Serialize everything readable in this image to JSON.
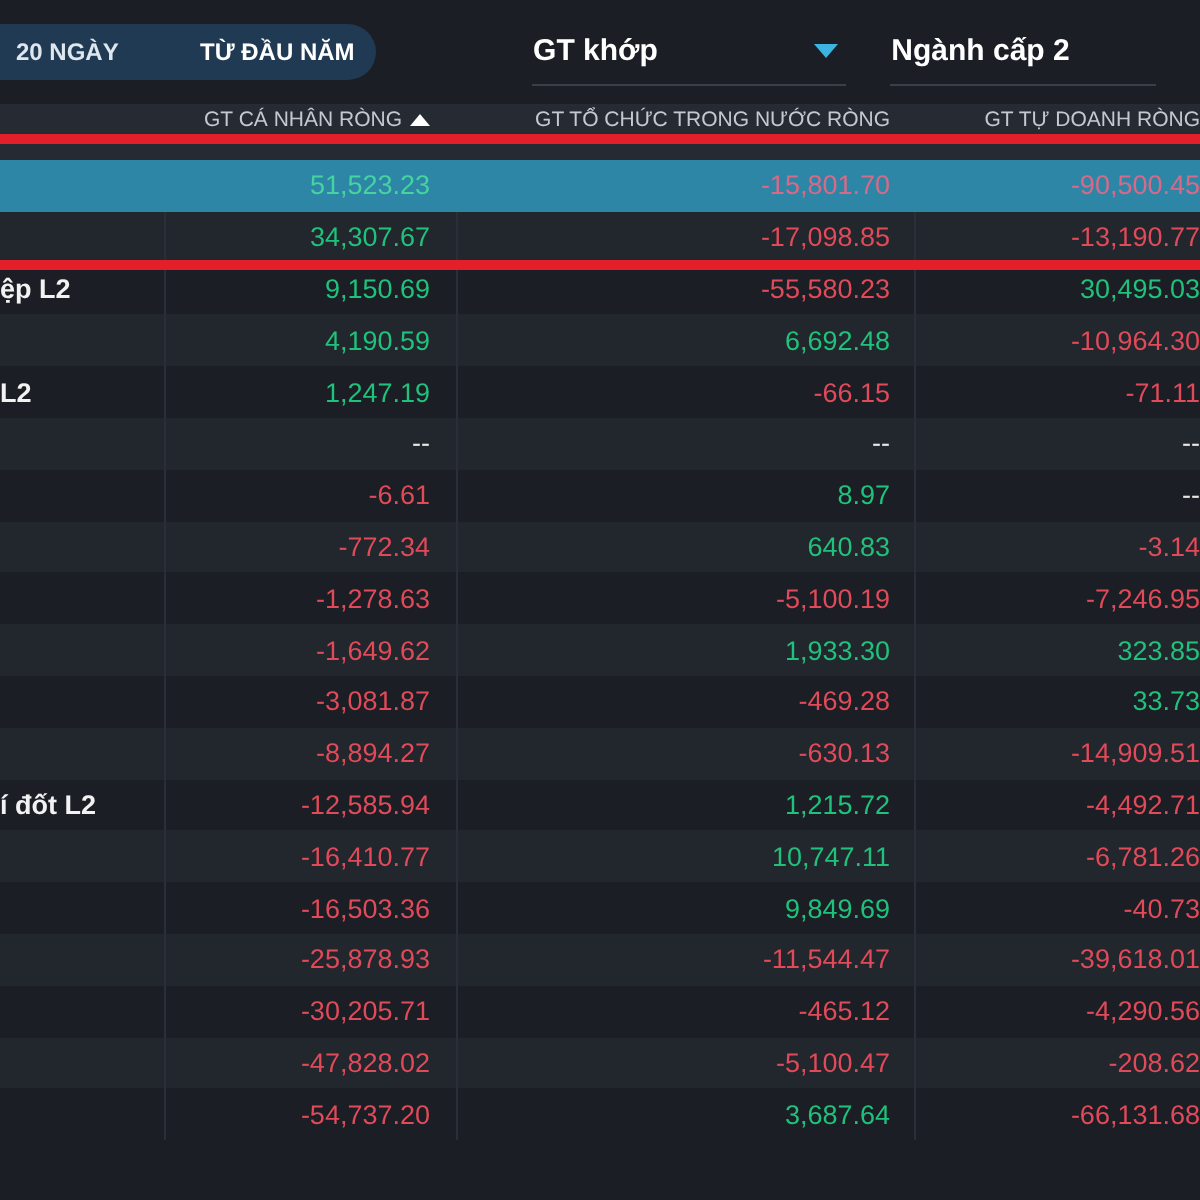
{
  "period_tabs": [
    {
      "label": "20 NGÀY",
      "selected": false
    },
    {
      "label": "TỪ ĐẦU NĂM",
      "selected": true
    }
  ],
  "filters": [
    {
      "value": "GT khớp",
      "caret": true
    },
    {
      "value": "Ngành cấp 2"
    }
  ],
  "table": {
    "columns": [
      {
        "label": "GT CÁ NHÂN RÒNG",
        "sorted": true
      },
      {
        "label": "GT TỔ CHỨC TRONG NƯỚC RÒNG",
        "sorted": false
      },
      {
        "label": "GT TỰ DOANH RÒNG",
        "sorted": false
      }
    ],
    "rows": [
      {
        "selected": true,
        "values": [
          {
            "text": "51,523.23",
            "kind": "up"
          },
          {
            "text": "-15,801.70",
            "kind": "down"
          },
          {
            "text": "-90,500.45",
            "kind": "down"
          }
        ]
      },
      {
        "selected": false,
        "marked": true,
        "values": [
          {
            "text": "34,307.67",
            "kind": "up"
          },
          {
            "text": "-17,098.85",
            "kind": "down"
          },
          {
            "text": "-13,190.77",
            "kind": "down"
          }
        ]
      },
      {
        "selected": false,
        "name": "ệp L2",
        "values": [
          {
            "text": "9,150.69",
            "kind": "up"
          },
          {
            "text": "-55,580.23",
            "kind": "down"
          },
          {
            "text": "30,495.03",
            "kind": "up"
          }
        ]
      },
      {
        "selected": false,
        "values": [
          {
            "text": "4,190.59",
            "kind": "up"
          },
          {
            "text": "6,692.48",
            "kind": "up"
          },
          {
            "text": "-10,964.30",
            "kind": "down"
          }
        ]
      },
      {
        "selected": false,
        "name": "L2",
        "values": [
          {
            "text": "1,247.19",
            "kind": "up"
          },
          {
            "text": "-66.15",
            "kind": "down"
          },
          {
            "text": "-71.11",
            "kind": "down"
          }
        ]
      },
      {
        "selected": false,
        "values": [
          {
            "text": "--",
            "kind": "none"
          },
          {
            "text": "--",
            "kind": "none"
          },
          {
            "text": "--",
            "kind": "none"
          }
        ]
      },
      {
        "selected": false,
        "values": [
          {
            "text": "-6.61",
            "kind": "down"
          },
          {
            "text": "8.97",
            "kind": "up"
          },
          {
            "text": "--",
            "kind": "none"
          }
        ]
      },
      {
        "selected": false,
        "values": [
          {
            "text": "-772.34",
            "kind": "down"
          },
          {
            "text": "640.83",
            "kind": "up"
          },
          {
            "text": "-3.14",
            "kind": "down"
          }
        ]
      },
      {
        "selected": false,
        "values": [
          {
            "text": "-1,278.63",
            "kind": "down"
          },
          {
            "text": "-5,100.19",
            "kind": "down"
          },
          {
            "text": "-7,246.95",
            "kind": "down"
          }
        ]
      },
      {
        "selected": false,
        "values": [
          {
            "text": "-1,649.62",
            "kind": "down"
          },
          {
            "text": "1,933.30",
            "kind": "up"
          },
          {
            "text": "323.85",
            "kind": "up"
          }
        ]
      },
      {
        "selected": false,
        "values": [
          {
            "text": "-3,081.87",
            "kind": "down"
          },
          {
            "text": "-469.28",
            "kind": "down"
          },
          {
            "text": "33.73",
            "kind": "up"
          }
        ]
      },
      {
        "selected": false,
        "values": [
          {
            "text": "-8,894.27",
            "kind": "down"
          },
          {
            "text": "-630.13",
            "kind": "down"
          },
          {
            "text": "-14,909.51",
            "kind": "down"
          }
        ]
      },
      {
        "selected": false,
        "name": "í đốt L2",
        "values": [
          {
            "text": "-12,585.94",
            "kind": "down"
          },
          {
            "text": "1,215.72",
            "kind": "up"
          },
          {
            "text": "-4,492.71",
            "kind": "down"
          }
        ]
      },
      {
        "selected": false,
        "values": [
          {
            "text": "-16,410.77",
            "kind": "down"
          },
          {
            "text": "10,747.11",
            "kind": "up"
          },
          {
            "text": "-6,781.26",
            "kind": "down"
          }
        ]
      },
      {
        "selected": false,
        "values": [
          {
            "text": "-16,503.36",
            "kind": "down"
          },
          {
            "text": "9,849.69",
            "kind": "up"
          },
          {
            "text": "-40.73",
            "kind": "down"
          }
        ]
      },
      {
        "selected": false,
        "values": [
          {
            "text": "-25,878.93",
            "kind": "down"
          },
          {
            "text": "-11,544.47",
            "kind": "down"
          },
          {
            "text": "-39,618.01",
            "kind": "down"
          }
        ]
      },
      {
        "selected": false,
        "values": [
          {
            "text": "-30,205.71",
            "kind": "down"
          },
          {
            "text": "-465.12",
            "kind": "down"
          },
          {
            "text": "-4,290.56",
            "kind": "down"
          }
        ]
      },
      {
        "selected": false,
        "values": [
          {
            "text": "-47,828.02",
            "kind": "down"
          },
          {
            "text": "-5,100.47",
            "kind": "down"
          },
          {
            "text": "-208.62",
            "kind": "down"
          }
        ]
      },
      {
        "selected": false,
        "values": [
          {
            "text": "-54,737.20",
            "kind": "down"
          },
          {
            "text": "3,687.64",
            "kind": "up"
          },
          {
            "text": "-66,131.68",
            "kind": "down"
          }
        ]
      }
    ]
  },
  "header_marked": true
}
